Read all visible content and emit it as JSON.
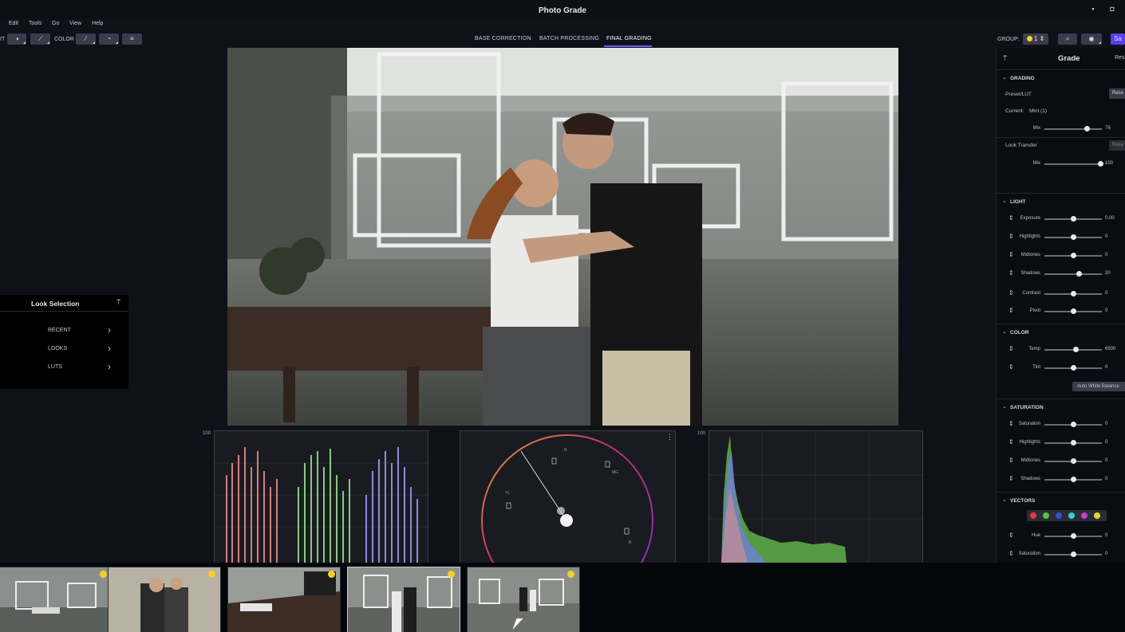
{
  "app": {
    "title": "Photo Grade"
  },
  "window_controls": {
    "minimize": "▪",
    "maximize": "◘"
  },
  "menu": [
    "Edit",
    "Tools",
    "Go",
    "View",
    "Help"
  ],
  "toolbar": {
    "left_label_edit": "IT",
    "color_label": "COLOR",
    "group_label": "GROUP:",
    "group_count": "1",
    "save_label": "Sa"
  },
  "tabs": [
    {
      "label": "BASE CORRECTION",
      "active": false
    },
    {
      "label": "BATCH PROCESSING",
      "active": false
    },
    {
      "label": "FINAL GRADING",
      "active": true
    }
  ],
  "look_panel": {
    "title": "Look Selection",
    "items": [
      "RECENT",
      "LOOKS",
      "LUTS"
    ]
  },
  "scopes": {
    "parade_max": "100",
    "histogram_max": "100",
    "vectorscope_labels": [
      "R",
      "MG",
      "YL",
      "B"
    ]
  },
  "right_panel": {
    "title": "Grade",
    "reset_label": "Res",
    "grading": {
      "title": "GRADING",
      "preset_label": "Preset/LUT",
      "preset_button": "Rese",
      "current_label": "Current:",
      "current_value": "Mint (1)",
      "mix_label": "Mix",
      "mix_value": "76",
      "look_transfer_label": "Look Transfer",
      "look_transfer_button": "Rese",
      "mix2_value": "100"
    },
    "light": {
      "title": "LIGHT",
      "rows": [
        {
          "label": "Exposure",
          "value": "0.00",
          "pos": 0.5
        },
        {
          "label": "Highlights",
          "value": "0",
          "pos": 0.5
        },
        {
          "label": "Midtones",
          "value": "0",
          "pos": 0.5
        },
        {
          "label": "Shadows",
          "value": "20",
          "pos": 0.6
        },
        {
          "label": "Contrast",
          "value": "0",
          "pos": 0.5
        },
        {
          "label": "Pivot",
          "value": "0",
          "pos": 0.5
        }
      ]
    },
    "color": {
      "title": "COLOR",
      "rows": [
        {
          "label": "Temp",
          "value": "6500",
          "pos": 0.54
        },
        {
          "label": "Tint",
          "value": "0",
          "pos": 0.5
        }
      ],
      "auto_wb_label": "Auto White Balance"
    },
    "saturation": {
      "title": "SATURATION",
      "rows": [
        {
          "label": "Saturation",
          "value": "0",
          "pos": 0.5
        },
        {
          "label": "Highlights",
          "value": "0",
          "pos": 0.5
        },
        {
          "label": "Midtones",
          "value": "0",
          "pos": 0.5
        },
        {
          "label": "Shadows",
          "value": "0",
          "pos": 0.5
        }
      ]
    },
    "vectors": {
      "title": "VECTORS",
      "swatches": [
        "#e23a3a",
        "#52c24a",
        "#3f4bd8",
        "#3cc7d6",
        "#c33fd0",
        "#e6d23a"
      ],
      "rows": [
        {
          "label": "Hue",
          "value": "0",
          "pos": 0.5
        },
        {
          "label": "Saturation",
          "value": "0",
          "pos": 0.5
        }
      ]
    }
  },
  "filmstrip": {
    "count": 5,
    "flagged": [
      true,
      true,
      true,
      true,
      true
    ],
    "selected_index": 3
  }
}
